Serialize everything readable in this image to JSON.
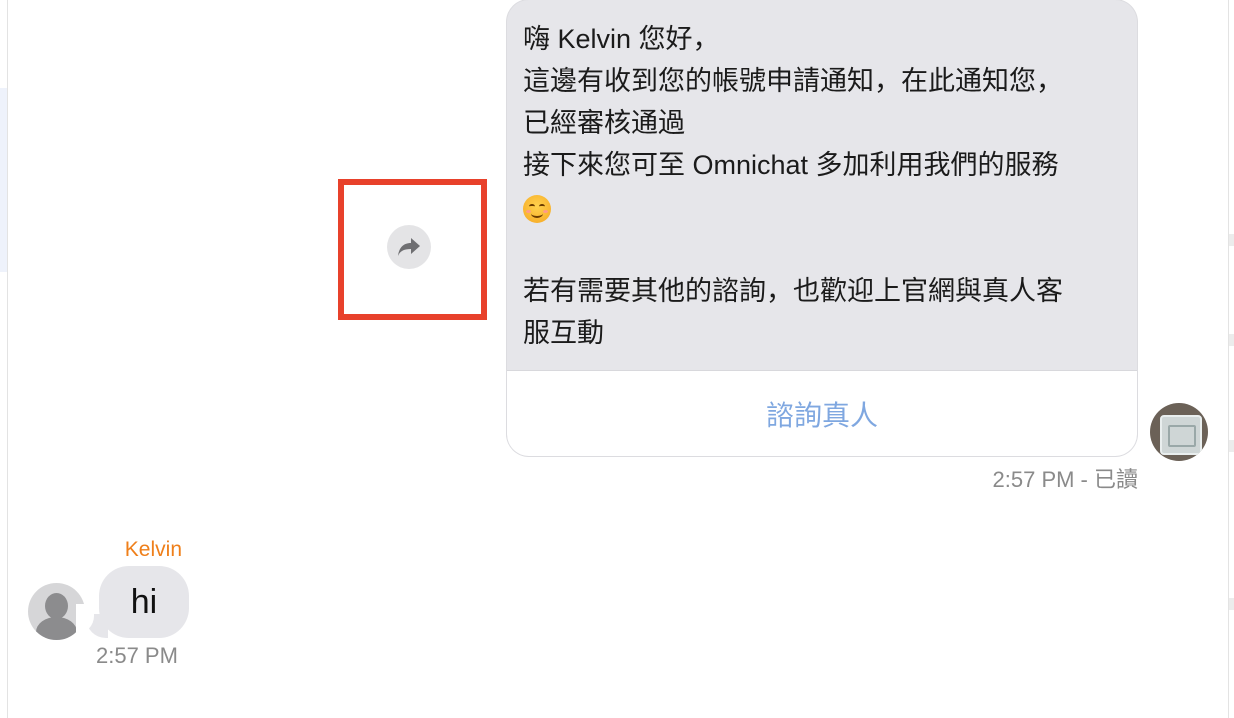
{
  "bot_message": {
    "line1": "嗨 Kelvin 您好，",
    "line2": "這邊有收到您的帳號申請通知，在此通知您，",
    "line3": "已經審核通過",
    "line4": "接下來您可至 Omnichat 多加利用我們的服務",
    "line6": "若有需要其他的諮詢，也歡迎上官網與真人客",
    "line7": "服互動",
    "emoji": "smiling-face-emoji",
    "button_label": "諮詢真人",
    "meta": "2:57 PM - 已讀"
  },
  "user_message": {
    "sender": "Kelvin",
    "text": "hi",
    "time": "2:57 PM"
  },
  "colors": {
    "bubble": "#e6e6ea",
    "button_text": "#7fa7e0",
    "sender_name": "#ef7f1a",
    "highlight": "#e8412b"
  }
}
